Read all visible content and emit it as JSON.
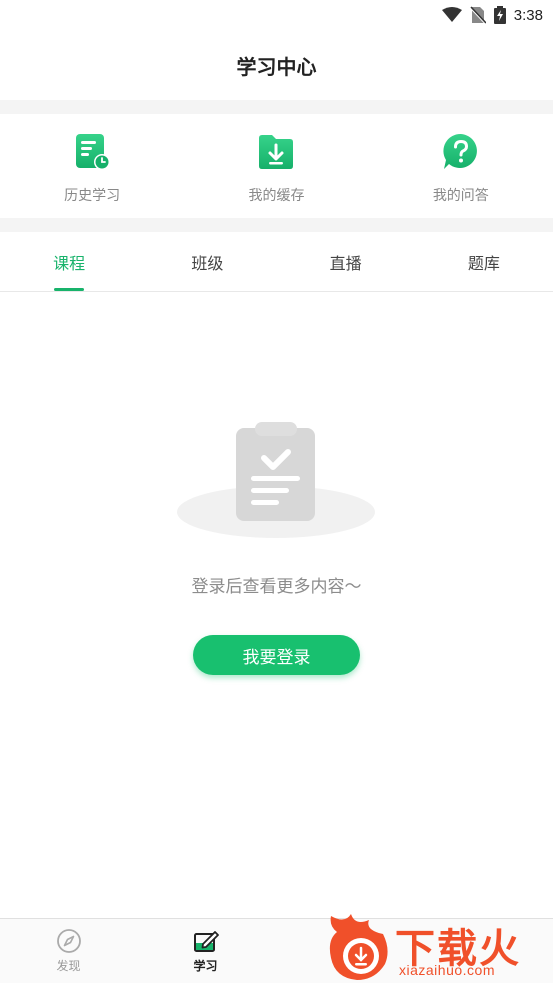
{
  "status_bar": {
    "time": "3:38"
  },
  "header": {
    "title": "学习中心"
  },
  "quick_actions": [
    {
      "label": "历史学习",
      "icon": "history-document-icon"
    },
    {
      "label": "我的缓存",
      "icon": "download-folder-icon"
    },
    {
      "label": "我的问答",
      "icon": "question-chat-icon"
    }
  ],
  "tabs": [
    {
      "label": "课程",
      "active": true
    },
    {
      "label": "班级",
      "active": false
    },
    {
      "label": "直播",
      "active": false
    },
    {
      "label": "题库",
      "active": false
    }
  ],
  "empty_state": {
    "message": "登录后查看更多内容～",
    "button_label": "我要登录",
    "icon": "clipboard-check-icon"
  },
  "bottom_nav": [
    {
      "label": "发现",
      "icon": "compass-icon",
      "active": false
    },
    {
      "label": "学习",
      "icon": "edit-note-icon",
      "active": true
    }
  ],
  "watermark": {
    "brand": "下载火",
    "domain": "xiazaihuo.com"
  },
  "colors": {
    "accent": "#18b36b",
    "button": "#18c06f",
    "watermark": "#f0502a"
  }
}
